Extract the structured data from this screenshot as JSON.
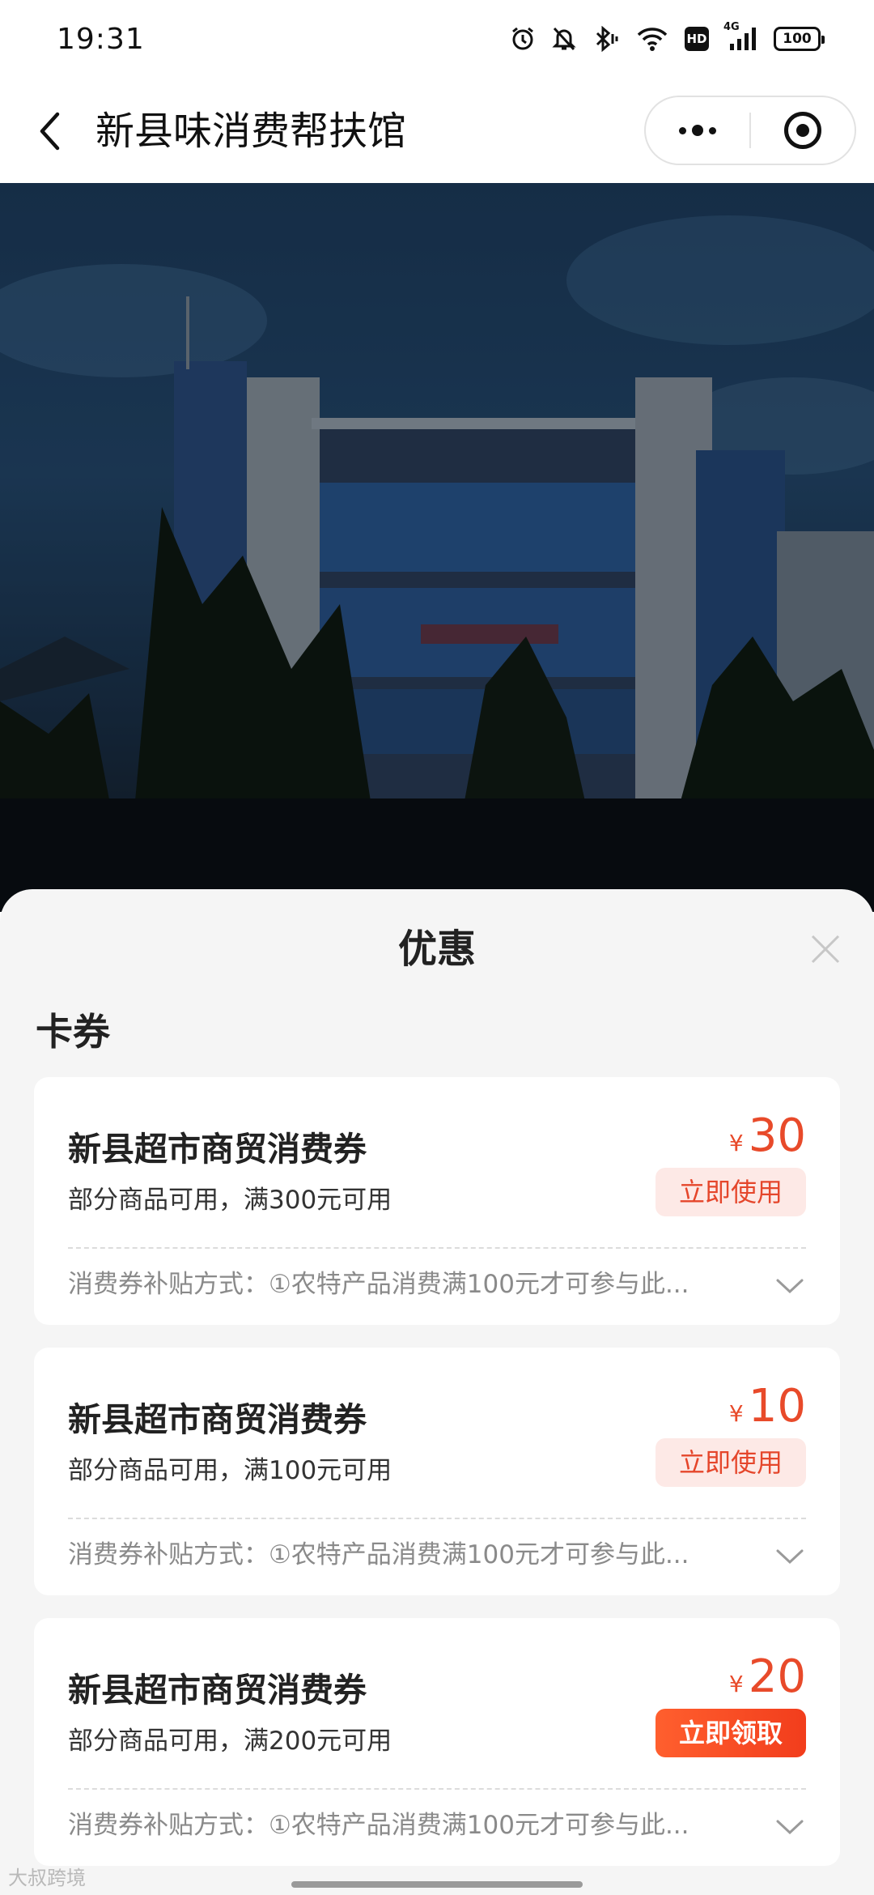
{
  "status_bar": {
    "time": "19:31",
    "battery": "100",
    "network": "4G",
    "hd": "HD",
    "icons": [
      "alarm-icon",
      "mute-icon",
      "bluetooth-icon",
      "wifi-icon",
      "hd-icon",
      "signal-icon",
      "battery-icon"
    ]
  },
  "nav": {
    "title": "新县味消费帮扶馆",
    "back_icon": "chevron-left-icon",
    "more_icon": "more-icon",
    "close_icon": "target-icon"
  },
  "hero": {
    "subject": "building-photo"
  },
  "sheet": {
    "title": "优惠",
    "section_title": "卡券",
    "close_icon": "close-icon"
  },
  "coupons": [
    {
      "name": "新县超市商贸消费券",
      "condition": "部分商品可用，满300元可用",
      "currency": "¥",
      "amount": "30",
      "button": "立即使用",
      "button_style": "use",
      "desc": "消费券补贴方式：①农特产品消费满100元才可参与此..."
    },
    {
      "name": "新县超市商贸消费券",
      "condition": "部分商品可用，满100元可用",
      "currency": "¥",
      "amount": "10",
      "button": "立即使用",
      "button_style": "use",
      "desc": "消费券补贴方式：①农特产品消费满100元才可参与此..."
    },
    {
      "name": "新县超市商贸消费券",
      "condition": "部分商品可用，满200元可用",
      "currency": "¥",
      "amount": "20",
      "button": "立即领取",
      "button_style": "claim",
      "desc": "消费券补贴方式：①农特产品消费满100元才可参与此..."
    }
  ],
  "watermark": "大叔跨境",
  "colors": {
    "accent": "#e84a2a",
    "claim_button": "#f23d1c",
    "use_button_bg": "#fde9e6",
    "sheet_bg": "#f5f5f5"
  }
}
